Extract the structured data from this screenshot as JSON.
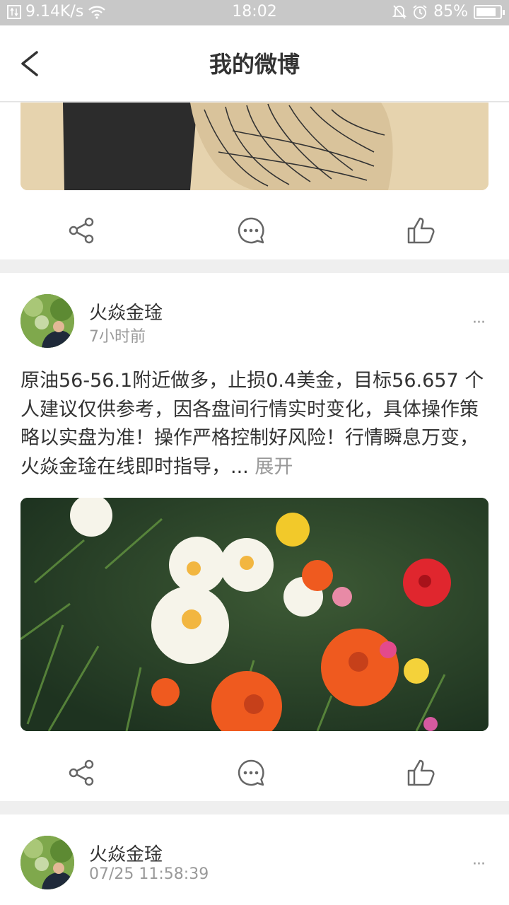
{
  "status_bar": {
    "speed": "9.14K/s",
    "time": "18:02",
    "battery_percent": "85%",
    "battery_level": 0.85
  },
  "nav": {
    "title": "我的微博"
  },
  "posts": [
    {
      "author": "火焱金琻",
      "time": "7小时前",
      "text": "原油56-56.1附近做多，止损0.4美金，目标56.657 个人建议仅供参考，因各盘间行情实时变化，具体操作策略以实盘为准！操作严格控制好风险！行情瞬息万变，火焱金琻在线即时指导，...",
      "expand_label": "展开",
      "more_label": "···"
    },
    {
      "author": "火焱金琻",
      "time": "07/25 11:58:39",
      "more_label": "···"
    }
  ],
  "icons": {
    "back": "chevron-left-icon",
    "share": "share-icon",
    "comment": "comment-icon",
    "like": "thumbs-up-icon",
    "wifi": "wifi-icon",
    "alarm": "alarm-icon",
    "mute": "bell-off-icon"
  }
}
